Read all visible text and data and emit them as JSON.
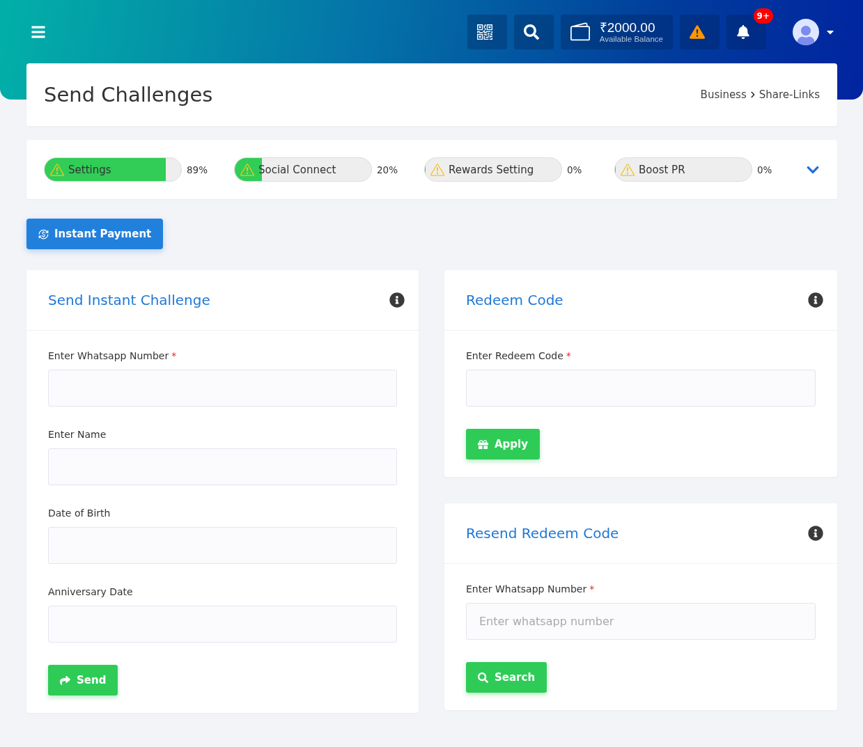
{
  "topbar": {
    "balance": {
      "amount": "₹2000.00",
      "label": "Available Balance"
    },
    "notification_badge": "9+"
  },
  "page_header": {
    "title": "Send Challenges",
    "breadcrumb": [
      "Business",
      "Share-Links"
    ]
  },
  "progress_steps": [
    {
      "label": "Settings",
      "level": 0.89,
      "reading": "89%"
    },
    {
      "label": "Social Connect",
      "level": 0.2,
      "reading": "20%"
    },
    {
      "label": "Rewards Setting",
      "level": 0,
      "reading": "0%"
    },
    {
      "label": "Boost PR",
      "level": 0,
      "reading": "0%"
    }
  ],
  "instant_payment_button": "Instant Payment",
  "left_column": [
    {
      "title": "Send Instant Challenge",
      "fields": [
        {
          "label": "Enter Whatsapp Number",
          "required_mark": "*"
        },
        {
          "label": "Enter Name"
        },
        {
          "label": "Date of Birth"
        },
        {
          "label": "Anniversary Date"
        }
      ],
      "button": {
        "label": "Send",
        "kind": "share"
      }
    }
  ],
  "right_column": [
    {
      "title": "Redeem Code",
      "fields": [
        {
          "label": "Enter Redeem Code",
          "required_mark": "*"
        }
      ],
      "button": {
        "label": "Apply",
        "kind": "gift"
      }
    },
    {
      "title": "Resend Redeem Code",
      "fields": [
        {
          "label": "Enter Whatsapp Number",
          "required_mark": "*",
          "placeholder": "Enter whatsapp number"
        }
      ],
      "button": {
        "label": "Search",
        "kind": "search"
      }
    }
  ]
}
